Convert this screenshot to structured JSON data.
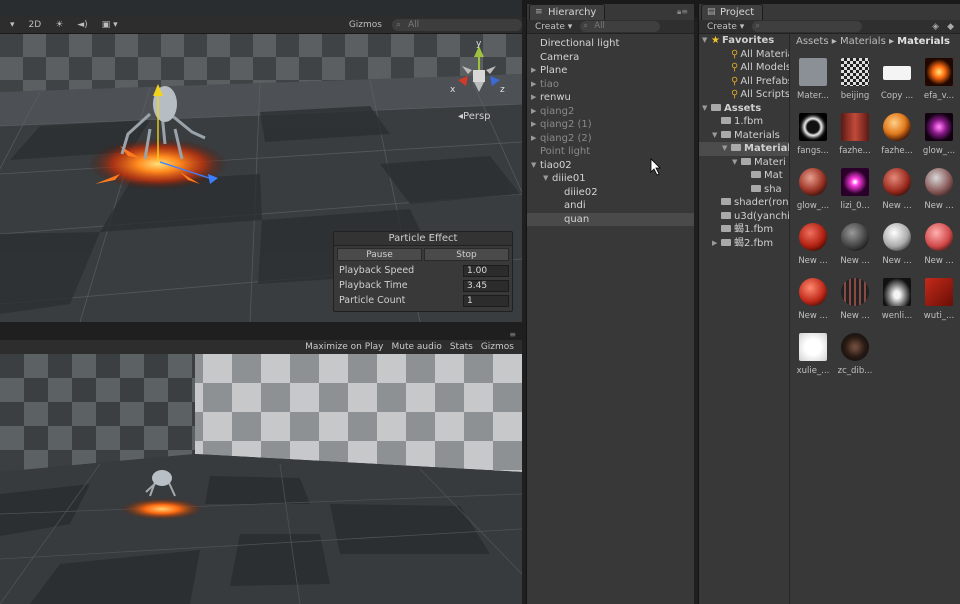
{
  "scene_toolbar": {
    "mode_2d": "2D",
    "gizmos_label": "Gizmos",
    "search_placeholder": "All"
  },
  "scene": {
    "gizmo_axes": [
      "y",
      "x",
      "z"
    ],
    "persp_label": "Persp"
  },
  "particle_effect": {
    "title": "Particle Effect",
    "pause_label": "Pause",
    "stop_label": "Stop",
    "rows": [
      {
        "label": "Playback Speed",
        "value": "1.00"
      },
      {
        "label": "Playback Time",
        "value": "3.45"
      },
      {
        "label": "Particle Count",
        "value": "1"
      }
    ]
  },
  "game_toolbar": {
    "maximize_on_play": "Maximize on Play",
    "mute_audio": "Mute audio",
    "stats": "Stats",
    "gizmos": "Gizmos"
  },
  "hierarchy": {
    "tab_label": "Hierarchy",
    "create_label": "Create",
    "search_placeholder": "All",
    "items": [
      {
        "label": "Directional light",
        "indent": 0,
        "arrow": false,
        "dim": false,
        "selected": false
      },
      {
        "label": "Camera",
        "indent": 0,
        "arrow": false,
        "dim": false,
        "selected": false
      },
      {
        "label": "Plane",
        "indent": 0,
        "arrow": "right",
        "dim": false,
        "selected": false
      },
      {
        "label": "tiao",
        "indent": 0,
        "arrow": "right",
        "dim": true,
        "selected": false
      },
      {
        "label": "renwu",
        "indent": 0,
        "arrow": "right",
        "dim": false,
        "selected": false
      },
      {
        "label": "qiang2",
        "indent": 0,
        "arrow": "right",
        "dim": true,
        "selected": false
      },
      {
        "label": "qiang2 (1)",
        "indent": 0,
        "arrow": "right",
        "dim": true,
        "selected": false
      },
      {
        "label": "qiang2 (2)",
        "indent": 0,
        "arrow": "right",
        "dim": true,
        "selected": false
      },
      {
        "label": "Point light",
        "indent": 0,
        "arrow": false,
        "dim": true,
        "selected": false
      },
      {
        "label": "tiao02",
        "indent": 0,
        "arrow": "down",
        "dim": false,
        "selected": false
      },
      {
        "label": "diiie01",
        "indent": 1,
        "arrow": "down",
        "dim": false,
        "selected": false
      },
      {
        "label": "diiie02",
        "indent": 2,
        "arrow": false,
        "dim": false,
        "selected": false
      },
      {
        "label": "andi",
        "indent": 2,
        "arrow": false,
        "dim": false,
        "selected": false
      },
      {
        "label": "quan",
        "indent": 2,
        "arrow": false,
        "dim": false,
        "selected": true
      }
    ]
  },
  "project": {
    "tab_label": "Project",
    "create_label": "Create",
    "tree": [
      {
        "label": "Favorites",
        "type": "star",
        "indent": 0,
        "arrow": "down",
        "bold": true,
        "selected": false
      },
      {
        "label": "All Materials",
        "type": "search",
        "indent": 2,
        "arrow": false,
        "bold": false,
        "selected": false
      },
      {
        "label": "All Models",
        "type": "search",
        "indent": 2,
        "arrow": false,
        "bold": false,
        "selected": false
      },
      {
        "label": "All Prefabs",
        "type": "search",
        "indent": 2,
        "arrow": false,
        "bold": false,
        "selected": false
      },
      {
        "label": "All Scripts",
        "type": "search",
        "indent": 2,
        "arrow": false,
        "bold": false,
        "selected": false
      },
      {
        "label": "Assets",
        "type": "folder",
        "indent": 0,
        "arrow": "down",
        "bold": true,
        "selected": false
      },
      {
        "label": "1.fbm",
        "type": "folder",
        "indent": 1,
        "arrow": false,
        "bold": false,
        "selected": false
      },
      {
        "label": "Materials",
        "type": "folder",
        "indent": 1,
        "arrow": "down",
        "bold": false,
        "selected": false
      },
      {
        "label": "Materials",
        "type": "folder",
        "indent": 2,
        "arrow": "down",
        "bold": true,
        "selected": true
      },
      {
        "label": "Materi",
        "type": "folder",
        "indent": 3,
        "arrow": "down",
        "bold": false,
        "selected": false
      },
      {
        "label": "Mat",
        "type": "folder",
        "indent": 4,
        "arrow": false,
        "bold": false,
        "selected": false
      },
      {
        "label": "sha",
        "type": "folder",
        "indent": 4,
        "arrow": false,
        "bold": false,
        "selected": false
      },
      {
        "label": "shader(ron",
        "type": "folder",
        "indent": 1,
        "arrow": false,
        "bold": false,
        "selected": false
      },
      {
        "label": "u3d(yanchi",
        "type": "folder",
        "indent": 1,
        "arrow": false,
        "bold": false,
        "selected": false
      },
      {
        "label": "蝎1.fbm",
        "type": "folder",
        "indent": 1,
        "arrow": false,
        "bold": false,
        "selected": false
      },
      {
        "label": "蝎2.fbm",
        "type": "folder",
        "indent": 1,
        "arrow": "right",
        "bold": false,
        "selected": false
      }
    ],
    "breadcrumb": [
      "Assets",
      "Materials",
      "Materials"
    ],
    "assets": [
      {
        "label": "Mater...",
        "kind": "folder"
      },
      {
        "label": "beijing",
        "kind": "checker"
      },
      {
        "label": "Copy ...",
        "kind": "white"
      },
      {
        "label": "efa_v...",
        "kind": "burst-orange"
      },
      {
        "label": "fangs...",
        "kind": "ring-white"
      },
      {
        "label": "fazhe...",
        "kind": "red-dark"
      },
      {
        "label": "fazhe...",
        "kind": "sphere-orange"
      },
      {
        "label": "glow_...",
        "kind": "glow-purple"
      },
      {
        "label": "glow_...",
        "kind": "sphere-red"
      },
      {
        "label": "lizi_0...",
        "kind": "glow-magenta"
      },
      {
        "label": "New ...",
        "kind": "sphere-red2"
      },
      {
        "label": "New ...",
        "kind": "sphere-grey-red"
      },
      {
        "label": "New ...",
        "kind": "sphere-red3"
      },
      {
        "label": "New ...",
        "kind": "sphere-dark"
      },
      {
        "label": "New ...",
        "kind": "sphere-white"
      },
      {
        "label": "New ...",
        "kind": "sphere-pink"
      },
      {
        "label": "New ...",
        "kind": "sphere-red4"
      },
      {
        "label": "New ...",
        "kind": "sphere-stripes"
      },
      {
        "label": "wenli...",
        "kind": "cloud"
      },
      {
        "label": "wuti_...",
        "kind": "red-flat"
      },
      {
        "label": "xulie_...",
        "kind": "white-soft"
      },
      {
        "label": "zc_dib...",
        "kind": "dark-blob"
      }
    ]
  },
  "colors": {
    "accent_selected": "#4a4a4a",
    "favorite_star": "#f2c12e",
    "fire": "#ff6a1a"
  }
}
